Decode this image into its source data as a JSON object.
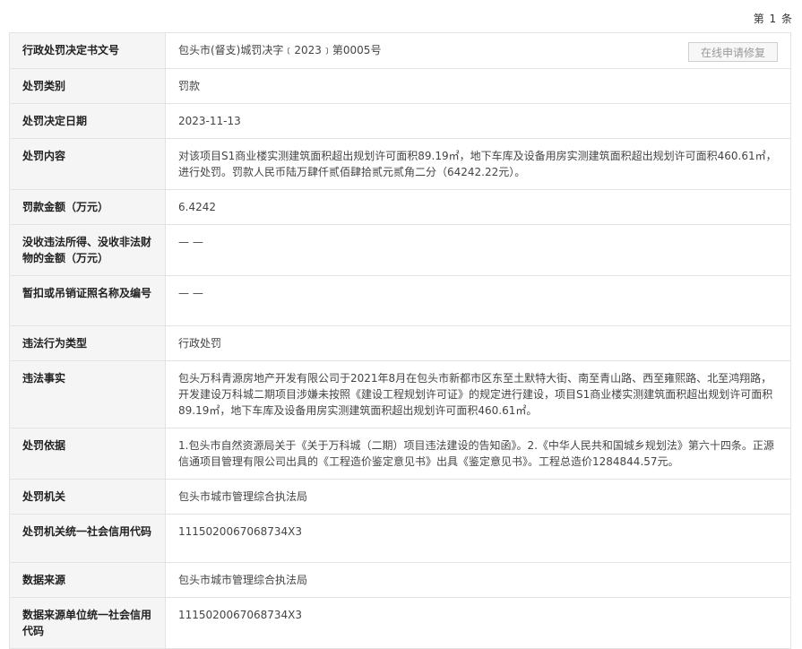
{
  "header": {
    "page_indicator": "第 1 条"
  },
  "record": {
    "repair_button_label": "在线申请修复",
    "rows": [
      {
        "label": "行政处罚决定书文号",
        "value": "包头市(督支)城罚决字﹝2023﹞第0005号"
      },
      {
        "label": "处罚类别",
        "value": "罚款"
      },
      {
        "label": "处罚决定日期",
        "value": "2023-11-13"
      },
      {
        "label": "处罚内容",
        "value": "对该项目S1商业楼实测建筑面积超出规划许可面积89.19㎡，地下车库及设备用房实测建筑面积超出规划许可面积460.61㎡，进行处罚。罚款人民币陆万肆仟贰佰肆拾贰元贰角二分（64242.22元）。"
      },
      {
        "label": "罚款金额（万元）",
        "value": "6.4242"
      },
      {
        "label": "没收违法所得、没收非法财物的金额（万元）",
        "value": "— —"
      },
      {
        "label": "暂扣或吊销证照名称及编号",
        "value": "— —"
      },
      {
        "label": "违法行为类型",
        "value": "行政处罚"
      },
      {
        "label": "违法事实",
        "value": "包头万科青源房地产开发有限公司于2021年8月在包头市新都市区东至土默特大街、南至青山路、西至雍熙路、北至鸿翔路，开发建设万科城二期项目涉嫌未按照《建设工程规划许可证》的规定进行建设，项目S1商业楼实测建筑面积超出规划许可面积89.19㎡，地下车库及设备用房实测建筑面积超出规划许可面积460.61㎡。"
      },
      {
        "label": "处罚依据",
        "value": "1.包头市自然资源局关于《关于万科城（二期）项目违法建设的告知函》。2.《中华人民共和国城乡规划法》第六十四条。正源信通项目管理有限公司出具的《工程造价鉴定意见书》出具《鉴定意见书》。工程总造价1284844.57元。"
      },
      {
        "label": "处罚机关",
        "value": "包头市城市管理综合执法局"
      },
      {
        "label": "处罚机关统一社会信用代码",
        "value": "1115020067068734X3"
      },
      {
        "label": "数据来源",
        "value": "包头市城市管理综合执法局"
      },
      {
        "label": "数据来源单位统一社会信用代码",
        "value": "1115020067068734X3"
      }
    ]
  }
}
